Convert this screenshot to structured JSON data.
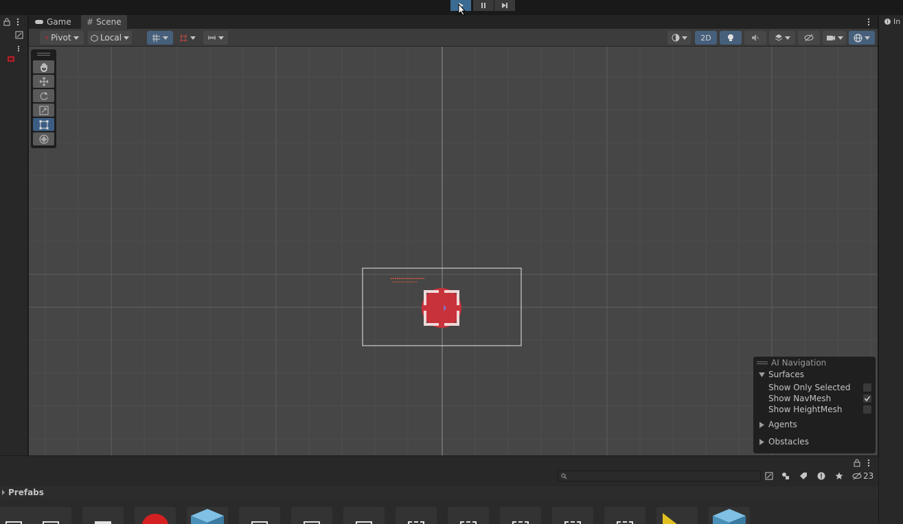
{
  "window": {
    "tabs": [
      {
        "label": "Game",
        "icon": "gamepad-icon"
      },
      {
        "label": "Scene",
        "icon": "hash-icon"
      }
    ],
    "right_tab_label": "In"
  },
  "toolbar": {
    "pivot_label": "Pivot",
    "local_label": "Local",
    "two_d_label": "2D"
  },
  "ai_navigation": {
    "title": "AI Navigation",
    "surfaces_label": "Surfaces",
    "options": [
      {
        "label": "Show Only Selected",
        "checked": false
      },
      {
        "label": "Show NavMesh",
        "checked": true
      },
      {
        "label": "Show HeightMesh",
        "checked": false
      }
    ],
    "agents_label": "Agents",
    "obstacles_label": "Obstacles"
  },
  "project": {
    "breadcrumb": "Prefabs",
    "hidden_count": "23"
  },
  "colors": {
    "accent": "#3b6a93",
    "viewport_bg": "#464646",
    "target_red": "#c8323a"
  }
}
